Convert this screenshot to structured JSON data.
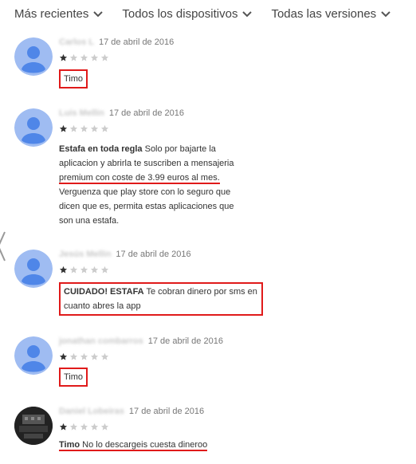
{
  "filters": [
    {
      "label": "Más recientes"
    },
    {
      "label": "Todos los dispositivos"
    },
    {
      "label": "Todas las versiones"
    }
  ],
  "colors": {
    "highlight": "#e01a1a",
    "avatar_bg": "#9fbcf2",
    "avatar_fg": "#4f86e8",
    "star_filled": "#333333",
    "star_empty": "#cccccc"
  },
  "reviews": [
    {
      "author": "Carlos L",
      "date": "17 de abril de 2016",
      "rating": 1,
      "title": "",
      "body": "Timo"
    },
    {
      "author": "Luis Mellin",
      "date": "17 de abril de 2016",
      "rating": 1,
      "title": "Estafa en toda regla",
      "body_pre": " Solo por bajarte la aplicacion y abrirla te suscriben a mensajeria ",
      "body_mark": "premium con coste de 3.99 euros al mes.",
      "body_post": " Verguenza que play store con lo seguro que dicen que es, permita estas aplicaciones que son una estafa."
    },
    {
      "author": "Jesús Mellin",
      "date": "17 de abril de 2016",
      "rating": 1,
      "title": "CUIDADO! ESTAFA",
      "body": " Te cobran dinero por sms en cuanto abres la app"
    },
    {
      "author": "jonathan combarros",
      "date": "17 de abril de 2016",
      "rating": 1,
      "title": "",
      "body": "Timo"
    },
    {
      "author": "Daniel Lobeiras",
      "date": "17 de abril de 2016",
      "rating": 1,
      "title": "Timo",
      "body": " No lo descargeis cuesta dineroo"
    }
  ]
}
